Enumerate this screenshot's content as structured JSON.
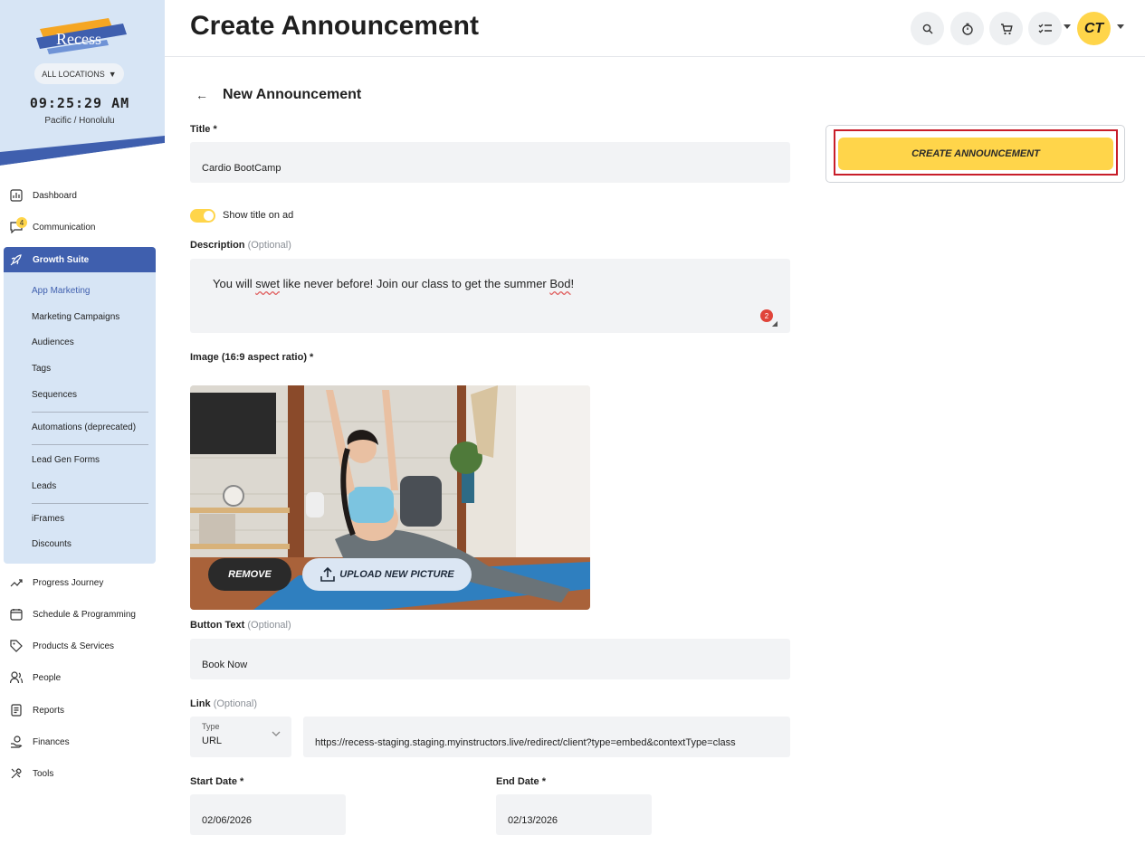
{
  "brand": {
    "logo_text": "Recess",
    "accent": "#ffd54a",
    "primary": "#3f5fae"
  },
  "sidebar": {
    "location_label": "ALL LOCATIONS",
    "clock": "09:25:29 AM",
    "timezone": "Pacific / Honolulu",
    "items": [
      {
        "label": "Dashboard",
        "icon": "dashboard-icon"
      },
      {
        "label": "Communication",
        "icon": "chat-icon",
        "badge": "4"
      },
      {
        "label": "Growth Suite",
        "icon": "rocket-icon",
        "active": true
      },
      {
        "label": "Progress Journey",
        "icon": "trend-icon"
      },
      {
        "label": "Schedule & Programming",
        "icon": "calendar-icon"
      },
      {
        "label": "Products & Services",
        "icon": "tag-icon"
      },
      {
        "label": "People",
        "icon": "people-icon"
      },
      {
        "label": "Reports",
        "icon": "report-icon"
      },
      {
        "label": "Finances",
        "icon": "finance-icon"
      },
      {
        "label": "Tools",
        "icon": "tools-icon"
      }
    ],
    "sub_items": [
      {
        "label": "App Marketing",
        "selected": true
      },
      {
        "label": "Marketing Campaigns"
      },
      {
        "label": "Audiences"
      },
      {
        "label": "Tags"
      },
      {
        "label": "Sequences"
      },
      {
        "label": "Automations (deprecated)"
      },
      {
        "label": "Lead Gen Forms"
      },
      {
        "label": "Leads"
      },
      {
        "label": "iFrames"
      },
      {
        "label": "Discounts"
      }
    ]
  },
  "header": {
    "title": "Create Announcement",
    "avatar_initials": "CT"
  },
  "form": {
    "back_arrow": "←",
    "subtitle": "New Announcement",
    "title_label": "Title *",
    "title_value": "Cardio BootCamp",
    "toggle_label": "Show title on ad",
    "description_label": "Description",
    "optional": "(Optional)",
    "description_parts": [
      "You will ",
      "swet",
      " like never before! Join our class to get the summer ",
      "Bod",
      "!"
    ],
    "description_error_count": "2",
    "image_label": "Image (16:9 aspect ratio) *",
    "remove_label": "REMOVE",
    "upload_label": "UPLOAD NEW PICTURE",
    "button_text_label": "Button Text",
    "button_text_value": "Book Now",
    "link_label": "Link",
    "link_type_label": "Type",
    "link_type_value": "URL",
    "link_value": "https://recess-staging.staging.myinstructors.live/redirect/client?type=embed&contextType=class",
    "start_date_label": "Start Date *",
    "start_date_value": "02/06/2026",
    "end_date_label": "End Date *",
    "end_date_value": "02/13/2026"
  },
  "actions": {
    "create_label": "CREATE ANNOUNCEMENT"
  }
}
